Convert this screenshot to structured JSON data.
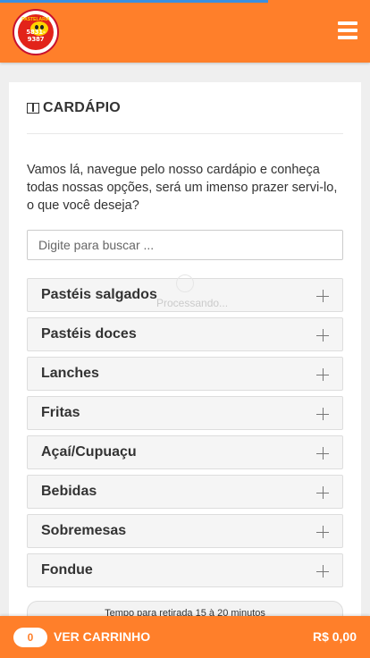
{
  "header": {
    "logo_top_text": "PASTELARIA",
    "logo_phone": "5831-9387"
  },
  "menu_card": {
    "title": "CARDÁPIO",
    "title_icon": "book-icon",
    "intro": "Vamos lá, navegue pelo nosso cardápio e conheça todas nossas opções, será um imenso prazer servi-lo, o que você deseja?",
    "search_placeholder": "Digite para buscar ...",
    "search_value": "",
    "processing_text": "Processando...",
    "categories": [
      {
        "label": "Pastéis salgados",
        "icon": "plus-icon"
      },
      {
        "label": "Pastéis doces",
        "icon": "plus-icon"
      },
      {
        "label": "Lanches",
        "icon": "plus-icon"
      },
      {
        "label": "Fritas",
        "icon": "plus-icon"
      },
      {
        "label": "Açaí/Cupuaçu",
        "icon": "plus-icon"
      },
      {
        "label": "Bebidas",
        "icon": "plus-icon"
      },
      {
        "label": "Sobremesas",
        "icon": "plus-icon"
      },
      {
        "label": "Fondue",
        "icon": "plus-icon"
      }
    ],
    "pickup_notice": "Tempo para retirada 15 à 20 minutos"
  },
  "cart_bar": {
    "count": "0",
    "label": "VER CARRINHO",
    "total": "R$ 0,00"
  },
  "colors": {
    "brand_orange": "#ff7f2a",
    "progress_blue": "#3a8fe0"
  }
}
